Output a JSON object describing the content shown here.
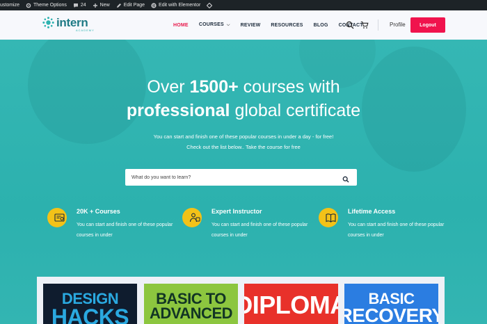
{
  "adminbar": {
    "items": [
      {
        "label": "ustomize",
        "icon": "customize-icon"
      },
      {
        "label": "Theme Options",
        "icon": "gear-icon"
      },
      {
        "label": "24",
        "icon": "comment-icon"
      },
      {
        "label": "New",
        "icon": "plus-icon"
      },
      {
        "label": "Edit Page",
        "icon": "pencil-icon"
      },
      {
        "label": "Edit with Elementor",
        "icon": "elementor-icon"
      },
      {
        "label": "",
        "icon": "diamond-icon"
      }
    ]
  },
  "header": {
    "logo": {
      "text_main": "intern",
      "subtext": "ACADEMY"
    },
    "nav": [
      {
        "label": "HOME",
        "active": true
      },
      {
        "label": "COURSES",
        "active": false,
        "has_dropdown": true
      },
      {
        "label": "REVIEW",
        "active": false
      },
      {
        "label": "RESOURCES",
        "active": false
      },
      {
        "label": "BLOG",
        "active": false
      },
      {
        "label": "CONTACT",
        "active": false
      }
    ],
    "profile_label": "Profile",
    "logout_label": "Logout"
  },
  "hero": {
    "title_line1_pre": "Over ",
    "title_line1_bold": "1500+",
    "title_line1_post": " courses with",
    "title_line2_bold": "professional",
    "title_line2_post": " global certificate",
    "subtitle_line1": "You can start and finish one of these popular courses in under a day - for free!",
    "subtitle_line2": "Check out the list below.. Take the course for free",
    "search_placeholder": "What do you want to learn?"
  },
  "features": [
    {
      "title": "20K + Courses",
      "description": "You can start and finish one of these popular courses in under",
      "icon": "certificate-icon"
    },
    {
      "title": "Expert Instructor",
      "description": "You can start and finish one of these popular courses in under",
      "icon": "instructor-icon"
    },
    {
      "title": "Lifetime Access",
      "description": "You can start and finish one of these popular courses in under",
      "icon": "book-icon"
    }
  ],
  "course_cards": [
    {
      "line1": "DESIGN",
      "line2": "HACKS",
      "bg": "#0f1c2e",
      "line1_color": "#2aa9e0",
      "line2_color": "#2aa9e0"
    },
    {
      "line1": "BASIC TO",
      "line2": "ADVANCED",
      "bg": "#8cc63f",
      "line1_color": "#123524",
      "line2_color": "#123524"
    },
    {
      "line1": "DIPLOMA",
      "line2": "",
      "bg": "#e8312a",
      "line1_color": "#ffffff",
      "line2_color": "#ffffff"
    },
    {
      "line1": "BASIC",
      "line2": "RECOVERY",
      "bg": "#2b7de1",
      "line1_color": "#ffffff",
      "line2_color": "#ffffff"
    }
  ],
  "colors": {
    "brand_teal": "#2eb3b0",
    "active_nav": "#e8194b",
    "logout_bg": "#f0134d",
    "feature_icon_bg": "#f3c218"
  }
}
